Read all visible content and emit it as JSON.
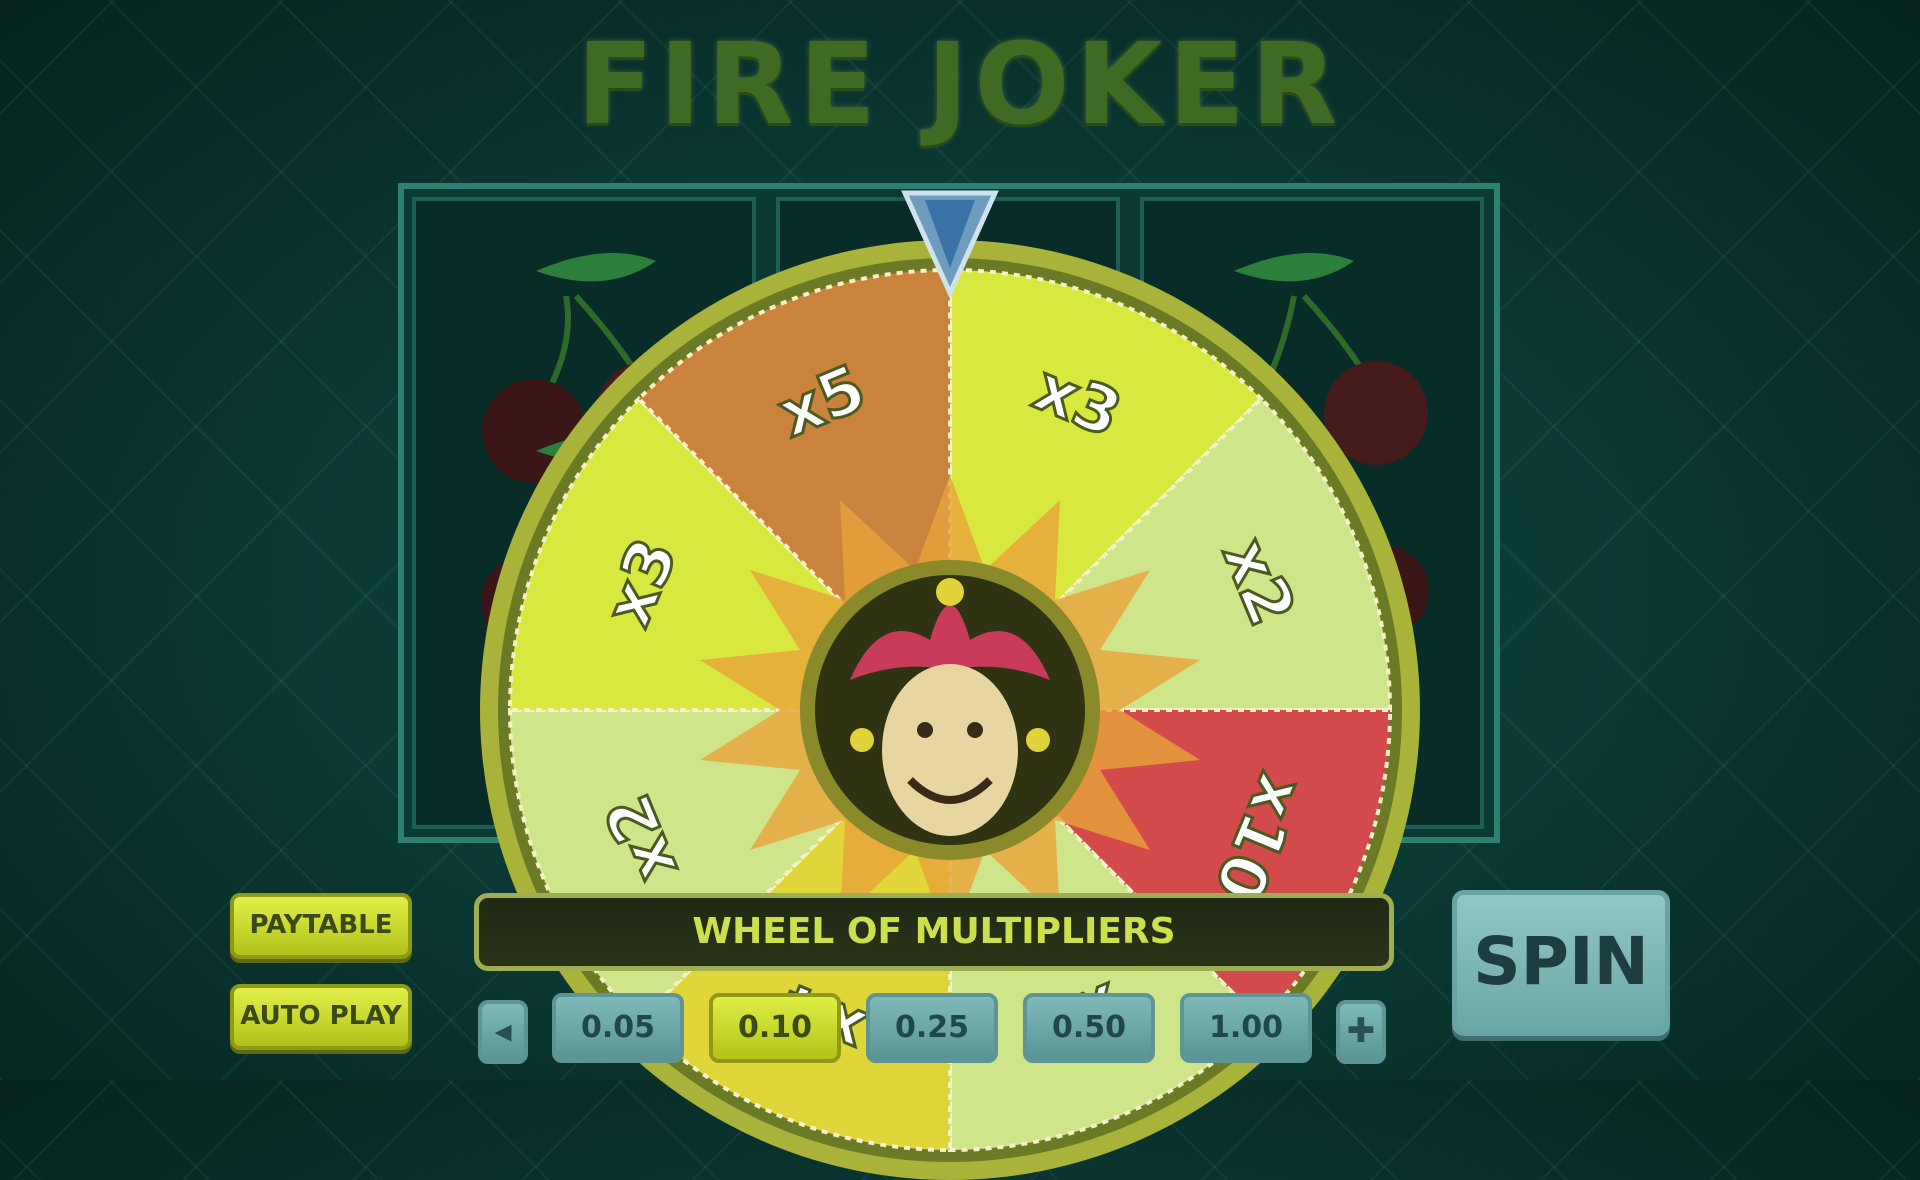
{
  "game": {
    "title": "FIRE JOKER"
  },
  "wheel": {
    "label": "WHEEL OF MULTIPLIERS",
    "segments": [
      {
        "label": "x3",
        "color": "#d8e83e"
      },
      {
        "label": "x2",
        "color": "#cfe58a"
      },
      {
        "label": "x10",
        "color": "#d24a4a"
      },
      {
        "label": "x2",
        "color": "#cfe58a"
      },
      {
        "label": "x4",
        "color": "#e0d63a"
      },
      {
        "label": "x2",
        "color": "#cfe58a"
      },
      {
        "label": "x3",
        "color": "#d8e83e"
      },
      {
        "label": "x5",
        "color": "#c9833c"
      }
    ]
  },
  "buttons": {
    "paytable": "PAYTABLE",
    "autoplay": "AUTO PLAY",
    "spin": "SPIN"
  },
  "bets": {
    "values": [
      "0.05",
      "0.10",
      "0.25",
      "0.50",
      "1.00"
    ],
    "selected": "0.10",
    "prev": "◂",
    "next": "✚"
  },
  "colors": {
    "accent": "#d8e83e",
    "background": "#0a3631"
  }
}
